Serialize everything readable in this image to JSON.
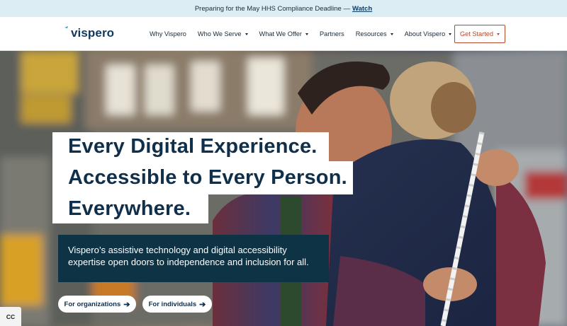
{
  "banner": {
    "text": "Preparing for the May HHS Compliance Deadline —",
    "link": "Watch"
  },
  "nav": {
    "logo": "vispero",
    "items": [
      {
        "label": "Why Vispero",
        "has_caret": false
      },
      {
        "label": "Who We Serve",
        "has_caret": true
      },
      {
        "label": "What We Offer",
        "has_caret": true
      },
      {
        "label": "Partners",
        "has_caret": false
      },
      {
        "label": "Resources",
        "has_caret": true
      },
      {
        "label": "About Vispero",
        "has_caret": true
      }
    ],
    "cta": "Get Started"
  },
  "hero": {
    "headline": [
      "Every Digital Experience.",
      "Accessible to Every Person.",
      "Everywhere."
    ],
    "description": "Vispero’s assistive technology and digital accessibility expertise open doors to independence and inclusion for all.",
    "buttons": [
      {
        "label": "For organizations"
      },
      {
        "label": "For individuals"
      }
    ]
  },
  "accessibility_widget": {
    "label": "CC",
    "icon": "captions-icon"
  },
  "colors": {
    "brand_navy": "#0f3b63",
    "banner_bg": "#dceef4",
    "cta_accent": "#b5472c",
    "description_bg": "#0e3344"
  }
}
